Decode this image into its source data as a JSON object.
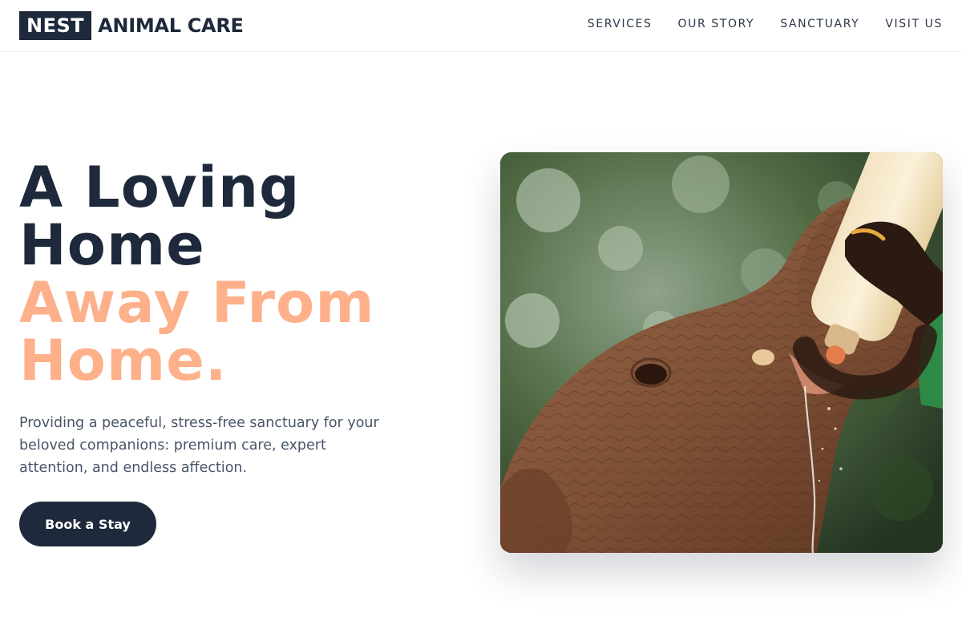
{
  "brand": {
    "mark": "NEST",
    "name": "ANIMAL CARE"
  },
  "nav": {
    "items": [
      "SERVICES",
      "OUR STORY",
      "SANCTUARY",
      "VISIT US"
    ]
  },
  "hero": {
    "headline_line1": "A Loving",
    "headline_line2": "Home",
    "headline_accent_line1": "Away From",
    "headline_accent_line2": "Home.",
    "description": "Providing a peaceful, stress-free sanctuary for your beloved companions: premium care, expert attention, and endless affection.",
    "cta_label": "Book a Stay"
  },
  "colors": {
    "primary": "#1e293b",
    "accent": "#fdb08a",
    "body_text": "#475569"
  },
  "image": {
    "subject": "baby-elephant-bottle-feeding"
  }
}
